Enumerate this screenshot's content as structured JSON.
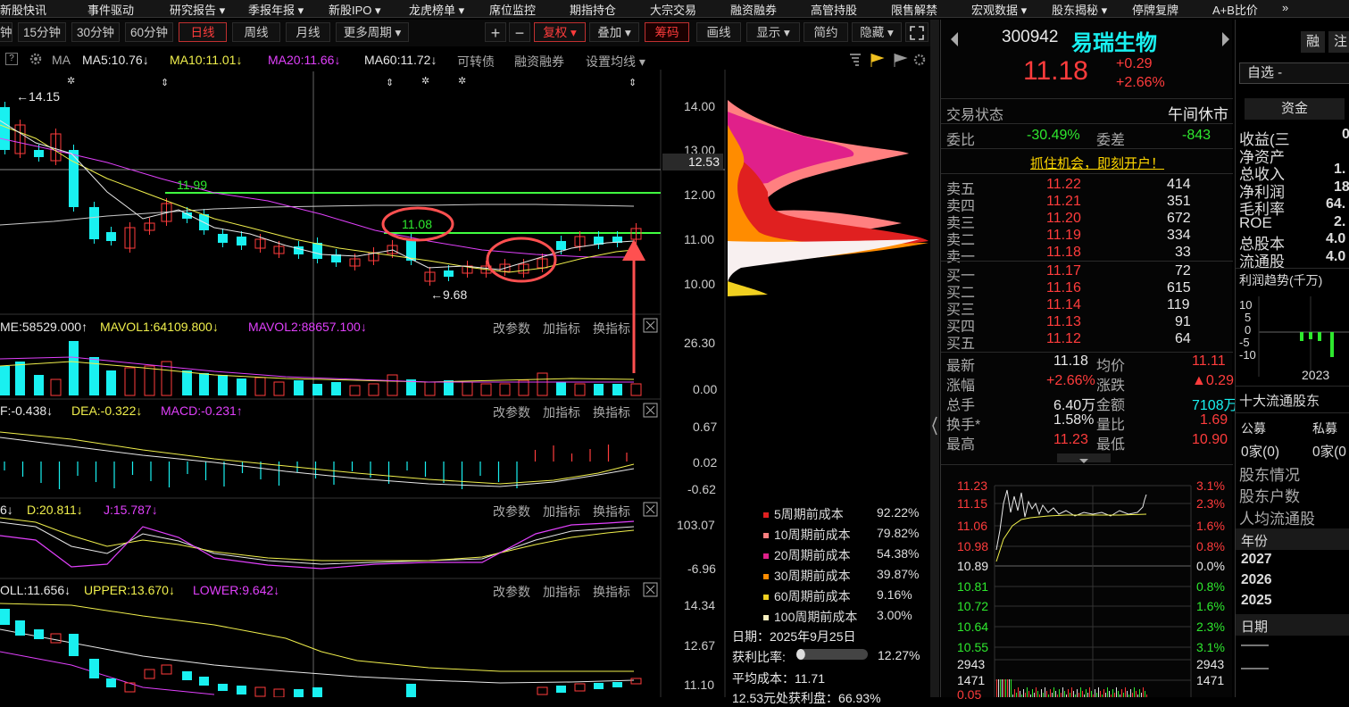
{
  "top_menu": [
    "新股快讯",
    "事件驱动",
    "研究报告 ▾",
    "季报年报 ▾",
    "新股IPO ▾",
    "龙虎榜单 ▾",
    "席位监控",
    "期指持仓",
    "大宗交易",
    "融资融券",
    "高管持股",
    "限售解禁",
    "宏观数据 ▾",
    "股东揭秘 ▾",
    "停牌复牌",
    "A+B比价",
    "»"
  ],
  "toolbar": {
    "periods": [
      "钟",
      "15分钟",
      "30分钟",
      "60分钟",
      "日线",
      "周线",
      "月线",
      "更多周期 ▾"
    ],
    "active_period": "日线",
    "plus": "+",
    "minus": "−",
    "fuquan": "复权 ▾",
    "diejia": "叠加 ▾",
    "chouma": "筹码",
    "huaxian": "画线",
    "xianshi": "显示 ▾",
    "jianyue": "简约",
    "yincang": "隐藏 ▾",
    "expand_icon": "expand-icon"
  },
  "ma_line": {
    "prefix": "MA",
    "ma5": "MA5:10.76↓",
    "ma10": "MA10:11.01↓",
    "ma20": "MA20:11.66↓",
    "ma60": "MA60:11.72↓",
    "kzz": "可转债",
    "rzrq": "融资融券",
    "shezhi": "设置均线 ▾"
  },
  "price_axis": [
    "14.00",
    "13.00",
    "12.00",
    "11.00",
    "10.00"
  ],
  "current_price_tag": "12.53",
  "annotations": {
    "high": "←14.15",
    "low": "←9.68",
    "line1": "11.99",
    "line2": "11.08"
  },
  "vol": {
    "label": "ME:58529.000↑",
    "mavol1": "MAVOL1:64109.800↓",
    "mavol2": "MAVOL2:88657.100↓",
    "axis": [
      "26.30",
      "0.00"
    ]
  },
  "macd": {
    "label": "F:-0.438↓",
    "dea": "DEA:-0.322↓",
    "macd": "MACD:-0.231↑",
    "axis": [
      "0.67",
      "0.02",
      "-0.62"
    ]
  },
  "kdj": {
    "label": "6↓",
    "d": "D:20.811↓",
    "j": "J:15.787↓",
    "axis": [
      "103.07",
      "-6.96"
    ]
  },
  "boll": {
    "label": "OLL:11.656↓",
    "upper": "UPPER:13.670↓",
    "lower": "LOWER:9.642↓",
    "axis": [
      "14.34",
      "12.67",
      "11.10"
    ]
  },
  "panel_buttons": [
    "改参数",
    "加指标",
    "换指标"
  ],
  "chip_legend": [
    {
      "label": "5周期前成本",
      "pct": "92.22%",
      "color": "#e02020"
    },
    {
      "label": "10周期前成本",
      "pct": "79.82%",
      "color": "#ff8080"
    },
    {
      "label": "20周期前成本",
      "pct": "54.38%",
      "color": "#e0208a"
    },
    {
      "label": "30周期前成本",
      "pct": "39.87%",
      "color": "#ff8c00"
    },
    {
      "label": "60周期前成本",
      "pct": "9.16%",
      "color": "#f0d020"
    },
    {
      "label": "100周期前成本",
      "pct": "3.00%",
      "color": "#f8f0c0"
    }
  ],
  "chip_info": {
    "date": "日期：2025年9月25日",
    "profit_ratio_label": "获利比率:",
    "profit_ratio": "12.27%",
    "profit_ratio_value": 0.1227,
    "avg_cost": "平均成本：11.71",
    "bottom": "12.53元处获利盘：66.93%"
  },
  "stock": {
    "code": "300942",
    "name": "易瑞生物",
    "price": "11.18",
    "change": "+0.29",
    "change_pct": "+2.66%"
  },
  "trade_status": {
    "label": "交易状态",
    "value": "午间休市"
  },
  "weibi": {
    "label": "委比",
    "value": "-30.49%",
    "wc_label": "委差",
    "wc_value": "-843"
  },
  "ad": "抓住机会，即刻开户！",
  "sell": [
    {
      "name": "卖五",
      "price": "11.22",
      "vol": "414"
    },
    {
      "name": "卖四",
      "price": "11.21",
      "vol": "351"
    },
    {
      "name": "卖三",
      "price": "11.20",
      "vol": "672"
    },
    {
      "name": "卖二",
      "price": "11.19",
      "vol": "334"
    },
    {
      "name": "卖一",
      "price": "11.18",
      "vol": "33"
    }
  ],
  "buy": [
    {
      "name": "买一",
      "price": "11.17",
      "vol": "72"
    },
    {
      "name": "买二",
      "price": "11.16",
      "vol": "615"
    },
    {
      "name": "买三",
      "price": "11.14",
      "vol": "119"
    },
    {
      "name": "买四",
      "price": "11.13",
      "vol": "91"
    },
    {
      "name": "买五",
      "price": "11.12",
      "vol": "64"
    }
  ],
  "stats": [
    {
      "l1": "最新",
      "v1": "11.18",
      "l2": "均价",
      "v2": "11.11"
    },
    {
      "l1": "涨幅",
      "v1": "+2.66%",
      "l2": "涨跌",
      "v2": "▲0.29"
    },
    {
      "l1": "总手",
      "v1": "6.40万",
      "l2": "金额",
      "v2": "7108万"
    },
    {
      "l1": "换手*",
      "v1": "1.58%",
      "l2": "量比",
      "v2": "1.69"
    },
    {
      "l1": "最高",
      "v1": "11.23",
      "l2": "最低",
      "v2": "10.90"
    }
  ],
  "intraday_axis_left": [
    "11.23",
    "11.15",
    "11.06",
    "10.98",
    "10.89",
    "10.81",
    "10.72",
    "10.64",
    "10.55",
    "2943",
    "1471",
    "0.05"
  ],
  "intraday_axis_right": [
    "3.1%",
    "2.3%",
    "1.6%",
    "0.8%",
    "0.0%",
    "0.8%",
    "1.6%",
    "2.3%",
    "3.1%",
    "2943",
    "1471"
  ],
  "far_right": {
    "buttons": [
      "融",
      "注"
    ],
    "zixuan": "自选 -",
    "zijin_tab": "资金",
    "fin": [
      {
        "l": "收益(三",
        "v": "0"
      },
      {
        "l": "净资产",
        "v": ""
      },
      {
        "l": "总收入",
        "v": "1."
      },
      {
        "l": "净利润",
        "v": "18"
      },
      {
        "l": "毛利率",
        "v": "64."
      },
      {
        "l": "ROE",
        "v": "2."
      },
      {
        "l": "总股本",
        "v": "4.0"
      },
      {
        "l": "流通股",
        "v": "4.0"
      }
    ],
    "trend_title": "利润趋势(千万)",
    "trend_axis": [
      "10",
      "5",
      "0",
      "-5",
      "-10"
    ],
    "trend_year": "2023",
    "holders_title": "十大流通股东",
    "gongmu": "公募",
    "simu": "私募",
    "gongmu_v": "0家(0)",
    "simu_v": "0家(0",
    "links": [
      "股东情况",
      "股东户数",
      "人均流通股"
    ],
    "year_title": "年份",
    "years": [
      "2027",
      "2026",
      "2025"
    ],
    "date_title": "日期",
    "dashes": [
      "——",
      "——"
    ]
  }
}
